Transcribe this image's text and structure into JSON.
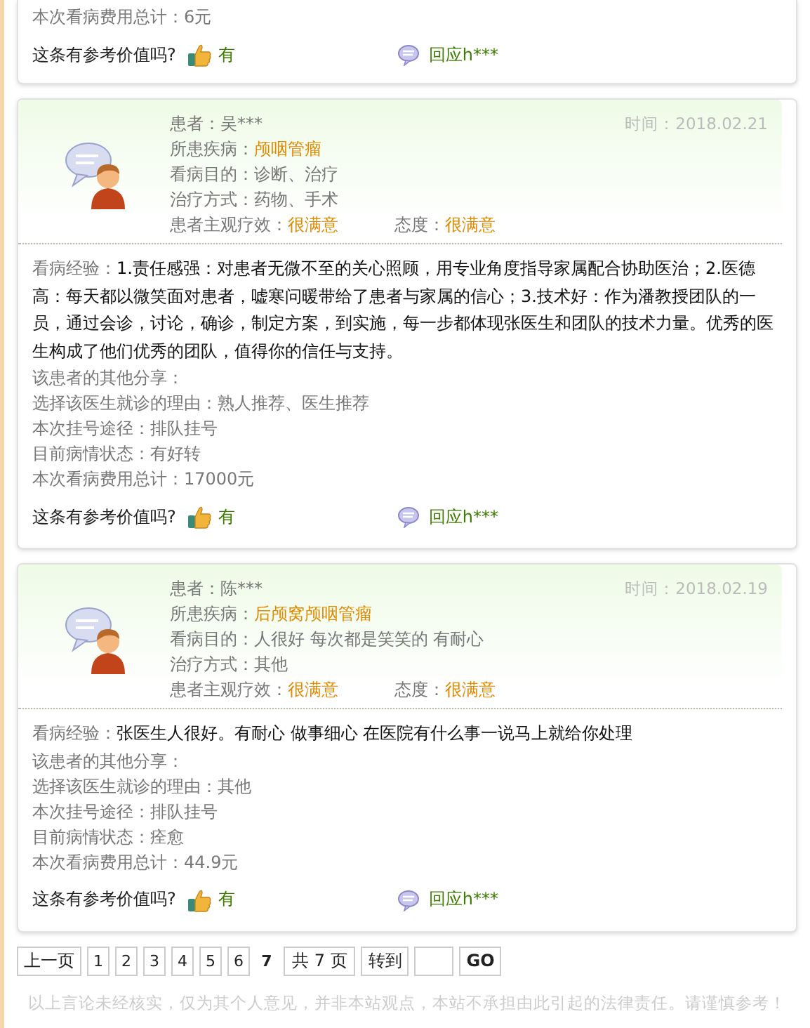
{
  "top_fragment": {
    "fee": {
      "label": "本次看病费用总计：",
      "value": "6元"
    },
    "helpful": {
      "question": "这条有参考价值吗?",
      "yes": "有",
      "reply": "回应h***"
    }
  },
  "reviews": [
    {
      "patient": {
        "label": "患者：",
        "value": "吴***"
      },
      "time": {
        "label": "时间：",
        "value": "2018.02.21"
      },
      "disease": {
        "label": "所患疾病：",
        "value": "颅咽管瘤"
      },
      "purpose": {
        "label": "看病目的：",
        "value": "诊断、治疗"
      },
      "treatment": {
        "label": "治疗方式：",
        "value": "药物、手术"
      },
      "effect": {
        "label": "患者主观疗效：",
        "value": "很满意"
      },
      "attitude": {
        "label": "态度：",
        "value": "很满意"
      },
      "experience": {
        "label": "看病经验：",
        "value": "1.责任感强：对患者无微不至的关心照顾，用专业角度指导家属配合协助医治；2.医德高：每天都以微笑面对患者，嘘寒问暖带给了患者与家属的信心；3.技术好：作为潘教授团队的一员，通过会诊，讨论，确诊，制定方案，到实施，每一步都体现张医生和团队的技术力量。优秀的医生构成了他们优秀的团队，值得你的信任与支持。"
      },
      "other_share": "该患者的其他分享：",
      "details": [
        {
          "label": "选择该医生就诊的理由：",
          "value": "熟人推荐、医生推荐"
        },
        {
          "label": "本次挂号途径：",
          "value": "排队挂号"
        },
        {
          "label": "目前病情状态：",
          "value": "有好转"
        },
        {
          "label": "本次看病费用总计：",
          "value": "17000元"
        }
      ],
      "helpful": {
        "question": "这条有参考价值吗?",
        "yes": "有",
        "reply": "回应h***"
      }
    },
    {
      "patient": {
        "label": "患者：",
        "value": "陈***"
      },
      "time": {
        "label": "时间：",
        "value": "2018.02.19"
      },
      "disease": {
        "label": "所患疾病：",
        "value": "后颅窝颅咽管瘤"
      },
      "purpose": {
        "label": "看病目的：",
        "value": "人很好 每次都是笑笑的 有耐心"
      },
      "treatment": {
        "label": "治疗方式：",
        "value": "其他"
      },
      "effect": {
        "label": "患者主观疗效：",
        "value": "很满意"
      },
      "attitude": {
        "label": "态度：",
        "value": "很满意"
      },
      "experience": {
        "label": "看病经验：",
        "value": "张医生人很好。有耐心 做事细心 在医院有什么事一说马上就给你处理"
      },
      "other_share": "该患者的其他分享：",
      "details": [
        {
          "label": "选择该医生就诊的理由：",
          "value": "其他"
        },
        {
          "label": "本次挂号途径：",
          "value": "排队挂号"
        },
        {
          "label": "目前病情状态：",
          "value": "痊愈"
        },
        {
          "label": "本次看病费用总计：",
          "value": "44.9元"
        }
      ],
      "helpful": {
        "question": "这条有参考价值吗?",
        "yes": "有",
        "reply": "回应h***"
      }
    }
  ],
  "pagination": {
    "prev": "上一页",
    "pages": [
      {
        "label": "1",
        "selected": false
      },
      {
        "label": "2",
        "selected": false
      },
      {
        "label": "3",
        "selected": false
      },
      {
        "label": "4",
        "selected": false
      },
      {
        "label": "5",
        "selected": false
      },
      {
        "label": "6",
        "selected": false
      },
      {
        "label": "7",
        "selected": true
      }
    ],
    "total": "共 7 页",
    "goto": "转到",
    "go": "GO"
  },
  "disclaimer": "以上言论未经核实，仅为其个人意见，并非本站观点，本站不承担由此引起的法律责任。请谨慎参考！"
}
